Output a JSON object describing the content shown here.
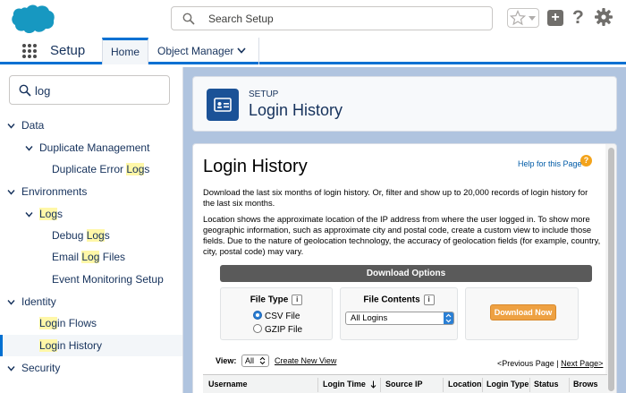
{
  "header": {
    "search_placeholder": "Search Setup",
    "help_glyph": "?"
  },
  "appnav": {
    "app_name": "Setup",
    "tabs": [
      {
        "label": "Home",
        "active": true
      },
      {
        "label": "Object Manager",
        "active": false
      }
    ]
  },
  "sidebar": {
    "quick_find_value": "log",
    "tree": [
      {
        "pre": "",
        "hl": "",
        "post": "Data",
        "level": 0
      },
      {
        "pre": "",
        "hl": "",
        "post": "Duplicate Management",
        "level": 1
      },
      {
        "pre": "Duplicate Error ",
        "hl": "Log",
        "post": "s",
        "level": 2
      },
      {
        "pre": "",
        "hl": "",
        "post": "Environments",
        "level": 0
      },
      {
        "pre": "",
        "hl": "Log",
        "post": "s",
        "level": 1
      },
      {
        "pre": "Debug ",
        "hl": "Log",
        "post": "s",
        "level": 2
      },
      {
        "pre": "Email ",
        "hl": "Log",
        "post": " Files",
        "level": 2
      },
      {
        "pre": "",
        "hl": "",
        "post": "Event Monitoring Setup",
        "level": 2
      },
      {
        "pre": "",
        "hl": "",
        "post": "Identity",
        "level": 0
      },
      {
        "pre": "",
        "hl": "Log",
        "post": "in Flows",
        "level": 2
      },
      {
        "pre": "",
        "hl": "Log",
        "post": "in History",
        "level": 2
      },
      {
        "pre": "",
        "hl": "",
        "post": "Security",
        "level": 0
      }
    ]
  },
  "page_header": {
    "eyebrow": "SETUP",
    "title": "Login History"
  },
  "content": {
    "title": "Login History",
    "help_link": "Help for this Page",
    "help_glyph": "?",
    "para1": "Download the last six months of login history. Or, filter and show up to 20,000 records of login history for the last six months.",
    "para2": "Location shows the approximate location of the IP address from where the user logged in. To show more geographic information, such as approximate city and postal code, create a custom view to include those fields. Due to the nature of geolocation technology, the accuracy of geolocation fields (for example, country, city, postal code) may vary.",
    "download": {
      "bar_label": "Download Options",
      "file_type_label": "File Type",
      "info_glyph": "i",
      "csv_label": "CSV File",
      "gzip_label": "GZIP File",
      "file_contents_label": "File Contents",
      "file_contents_value": "All Logins",
      "button_label": "Download Now"
    },
    "view": {
      "label": "View:",
      "value": "All",
      "create_link": "Create New View"
    },
    "pager": {
      "prev": "<Previous Page",
      "sep": " | ",
      "next": "Next Page>"
    },
    "columns": [
      "Username",
      "Login Time",
      "Source IP",
      "Location",
      "Login Type",
      "Status",
      "Brows"
    ]
  }
}
